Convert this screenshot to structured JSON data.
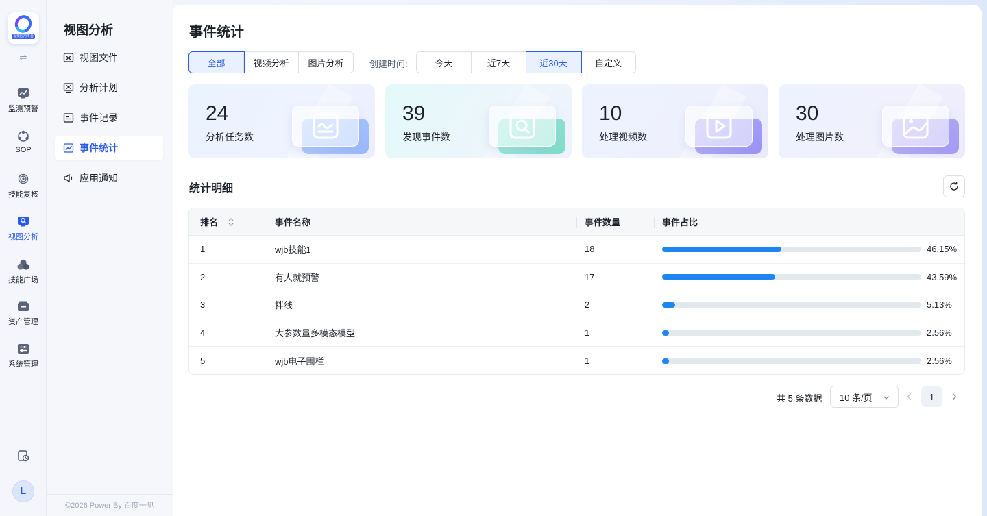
{
  "app": {
    "logo_text": "视觉应用平台",
    "rail_toggle": "⇌",
    "rail_items": [
      {
        "label": "监测预警",
        "icon": "monitor-chart-icon"
      },
      {
        "label": "SOP",
        "icon": "sop-flow-icon"
      },
      {
        "label": "技能复核",
        "icon": "skill-review-icon"
      },
      {
        "label": "视图分析",
        "icon": "view-analysis-icon",
        "active": true
      },
      {
        "label": "技能广场",
        "icon": "skill-square-icon"
      },
      {
        "label": "资产管理",
        "icon": "asset-icon"
      },
      {
        "label": "系统管理",
        "icon": "system-settings-icon"
      }
    ],
    "avatar_letter": "L",
    "accent": "#2a5ae8",
    "bar_color": "#1e86f0"
  },
  "sidebar": {
    "title": "视图分析",
    "items": [
      {
        "label": "视图文件",
        "icon": "file-image-icon"
      },
      {
        "label": "分析计划",
        "icon": "plan-icon"
      },
      {
        "label": "事件记录",
        "icon": "record-icon"
      },
      {
        "label": "事件统计",
        "icon": "statistics-icon",
        "active": true
      },
      {
        "label": "应用通知",
        "icon": "speaker-icon"
      }
    ],
    "footer": "©2026 Power By 百度一见"
  },
  "main": {
    "title": "事件统计",
    "type_filter": [
      "全部",
      "视频分析",
      "图片分析"
    ],
    "type_selected": "全部",
    "time_label": "创建时间:",
    "time_filter": [
      "今天",
      "近7天",
      "近30天",
      "自定义"
    ],
    "time_selected": "近30天",
    "stats": [
      {
        "value": "24",
        "label": "分析任务数",
        "icon": "trend-chart-icon"
      },
      {
        "value": "39",
        "label": "发现事件数",
        "icon": "search-image-icon"
      },
      {
        "value": "10",
        "label": "处理视频数",
        "icon": "play-video-icon"
      },
      {
        "value": "30",
        "label": "处理图片数",
        "icon": "picture-icon"
      }
    ],
    "section_title": "统计明细",
    "table": {
      "headers": [
        "排名",
        "事件名称",
        "事件数量",
        "事件占比"
      ],
      "rows": [
        {
          "rank": "1",
          "name": "wjb技能1",
          "count": "18",
          "pct": "46.15%",
          "ratio": 0.4615
        },
        {
          "rank": "2",
          "name": "有人就预警",
          "count": "17",
          "pct": "43.59%",
          "ratio": 0.4359
        },
        {
          "rank": "3",
          "name": "拌线",
          "count": "2",
          "pct": "5.13%",
          "ratio": 0.0513
        },
        {
          "rank": "4",
          "name": "大参数量多模态模型",
          "count": "1",
          "pct": "2.56%",
          "ratio": 0.0256
        },
        {
          "rank": "5",
          "name": "wjb电子围栏",
          "count": "1",
          "pct": "2.56%",
          "ratio": 0.0256
        }
      ]
    },
    "pagination": {
      "total": "共 5 条数据",
      "page_size": "10 条/页",
      "current": "1"
    }
  }
}
